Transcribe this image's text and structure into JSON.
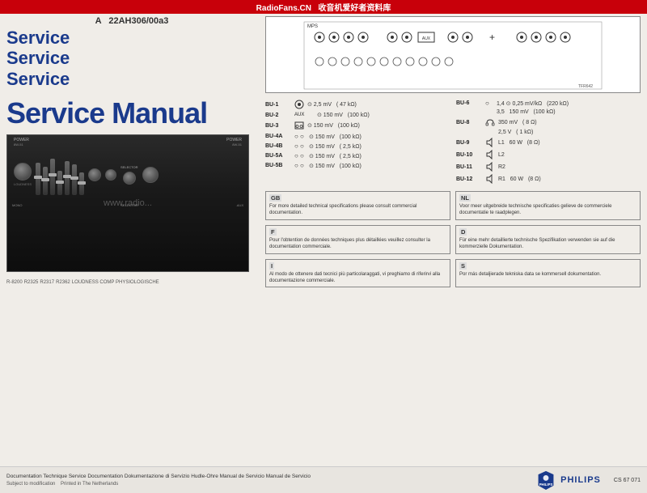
{
  "watermark": {
    "site": "RadioFans.CN",
    "subtitle": "收音机爱好者资料库"
  },
  "header": {
    "prefix": "A",
    "model": "22AH306/00a3"
  },
  "service_texts": [
    "Service",
    "Service",
    "Service"
  ],
  "manual_title": "Service Manual",
  "url_watermark": "www.radio...",
  "bottom": {
    "documentation_text": "Documentation Technique Service Documentation Dokumentazione di Servizio Hudle-Ohre Manual de Servicio Manual de Servicio",
    "sub_text": "Subject to modification",
    "print_text": "Printed in The Netherlands",
    "brand": "PHILIPS",
    "cs_number": "CS 67 071"
  },
  "connector_diagram": {
    "label": "MPS"
  },
  "specs": [
    {
      "id": "BU-1",
      "icon": "phono",
      "value": "2,5 mV",
      "impedance": "( 47 kΩ)"
    },
    {
      "id": "BU-2",
      "icon": "aux",
      "label": "AUX",
      "value": "150 mV",
      "impedance": "(100 kΩ)"
    },
    {
      "id": "BU-3",
      "icon": "tape",
      "value": "150 mV",
      "impedance": "(100 kΩ)"
    },
    {
      "id": "BU-4A",
      "icon": "circle2",
      "value": "150 mV",
      "impedance": "(100 kΩ)"
    },
    {
      "id": "BU-4B",
      "icon": "circle2",
      "value": "150 mV",
      "impedance": "( 2,5 kΩ)"
    },
    {
      "id": "BU-5A",
      "icon": "circle2",
      "value": "150 mV",
      "impedance": "( 2,5 kΩ)"
    },
    {
      "id": "BU-5B",
      "icon": "circle2",
      "value": "150 mV",
      "impedance": "(100 kΩ)"
    }
  ],
  "specs_right": [
    {
      "id": "BU-6",
      "icon": "circle1",
      "value": "1,4",
      "value2": "0,25 mV/kΩ",
      "impedance": "(220 kΩ)"
    },
    {
      "id": "",
      "icon": "",
      "value": "3,5",
      "value2": "150 mV",
      "impedance": "(100 kΩ)"
    },
    {
      "id": "BU-8",
      "icon": "headphone",
      "value": "350 mV",
      "impedance": "( 8 Ω)"
    },
    {
      "id": "",
      "icon": "",
      "value": "2,5 V",
      "impedance": "( 1 kΩ)"
    },
    {
      "id": "BU-9",
      "icon": "speaker",
      "label": "L1",
      "value": "60 W",
      "impedance": "(8 Ω)"
    },
    {
      "id": "BU-10",
      "icon": "speaker",
      "label": "L2",
      "value": "",
      "impedance": ""
    },
    {
      "id": "BU-11",
      "icon": "speaker",
      "label": "R2",
      "value": "",
      "impedance": ""
    },
    {
      "id": "BU-12",
      "icon": "speaker",
      "label": "R1",
      "value": "60 W",
      "impedance": "(8 Ω)"
    }
  ],
  "notes": [
    {
      "lang": "GB",
      "text": "For more detailed technical specifications please consult commercial documentation."
    },
    {
      "lang": "NL",
      "text": "Voor meer uitgebreide technische specificaties gelieve de commerciele documentatie te raadplegen."
    },
    {
      "lang": "F",
      "text": "Pour l'obtention de données techniques plus détaillées veuillez consulter la documentation commerciale."
    },
    {
      "lang": "D",
      "text": "Für eine mehr detaillierte technische Spezifikation verwenden sie auf die kommerzielle Dokumentation."
    },
    {
      "lang": "I",
      "text": "Al modo de ottenere dati tecnici più particolaraggati, vi preghiamo di riferirvi alla documentazione commerciale."
    },
    {
      "lang": "S",
      "text": "Por más detaljierade tekniska data se kommersell dokumentation."
    }
  ]
}
